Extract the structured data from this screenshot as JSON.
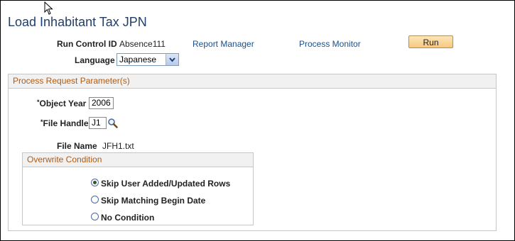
{
  "page": {
    "title": "Load Inhabitant Tax JPN"
  },
  "header": {
    "run_control_label": "Run Control ID",
    "run_control_value": "Absence111",
    "report_manager_link": "Report Manager",
    "process_monitor_link": "Process Monitor",
    "run_button": "Run",
    "language_label": "Language",
    "language_selected": "Japanese"
  },
  "params": {
    "group_title": "Process Request Parameter(s)",
    "object_year_label": "Object Year",
    "object_year_value": "2006",
    "file_handle_label": "File Handle",
    "file_handle_value": "J1",
    "required_marker": "*",
    "file_name_label": "File Name",
    "file_name_value": "JFH1.txt"
  },
  "overwrite": {
    "group_title": "Overwrite Condition",
    "options": [
      {
        "label": "Skip User Added/Updated Rows",
        "selected": true
      },
      {
        "label": "Skip Matching Begin Date",
        "selected": false
      },
      {
        "label": "No Condition",
        "selected": false
      }
    ]
  },
  "icons": {
    "lookup": "magnifier-icon",
    "dropdown": "chevron-down-icon",
    "cursor": "mouse-pointer-icon"
  }
}
